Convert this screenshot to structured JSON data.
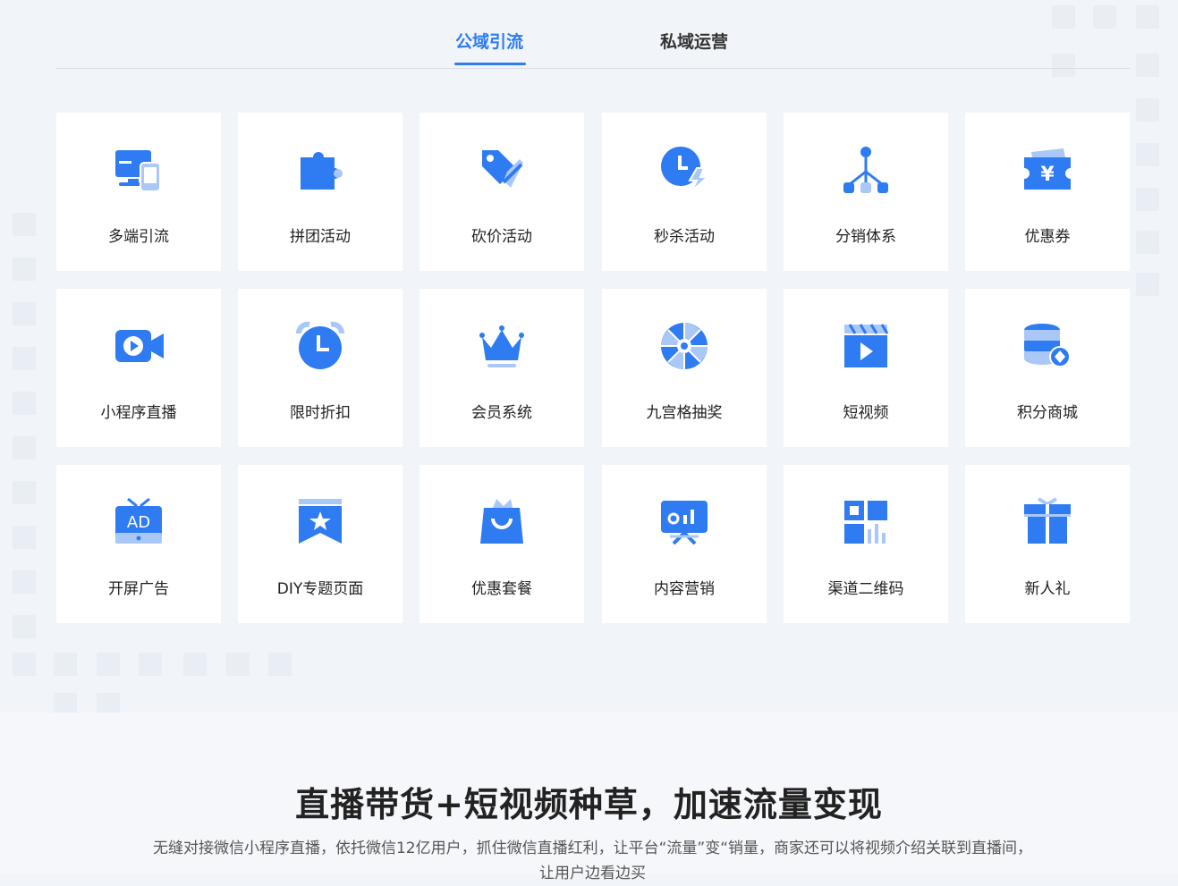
{
  "tabs": [
    {
      "label": "公域引流",
      "active": true
    },
    {
      "label": "私域运营",
      "active": false
    }
  ],
  "features": [
    {
      "label": "多端引流",
      "icon": "multi-device-icon"
    },
    {
      "label": "拼团活动",
      "icon": "puzzle-icon"
    },
    {
      "label": "砍价活动",
      "icon": "price-tag-icon"
    },
    {
      "label": "秒杀活动",
      "icon": "flash-clock-icon"
    },
    {
      "label": "分销体系",
      "icon": "hierarchy-icon"
    },
    {
      "label": "优惠券",
      "icon": "yen-ticket-icon"
    },
    {
      "label": "小程序直播",
      "icon": "video-camera-icon"
    },
    {
      "label": "限时折扣",
      "icon": "alarm-clock-icon"
    },
    {
      "label": "会员系统",
      "icon": "crown-icon"
    },
    {
      "label": "九宫格抽奖",
      "icon": "prize-wheel-icon"
    },
    {
      "label": "短视频",
      "icon": "clapperboard-icon"
    },
    {
      "label": "积分商城",
      "icon": "coin-stack-icon"
    },
    {
      "label": "开屏广告",
      "icon": "ad-tv-icon"
    },
    {
      "label": "DIY专题页面",
      "icon": "star-bookmark-icon"
    },
    {
      "label": "优惠套餐",
      "icon": "shopping-bag-icon"
    },
    {
      "label": "内容营销",
      "icon": "presentation-board-icon"
    },
    {
      "label": "渠道二维码",
      "icon": "qr-code-icon"
    },
    {
      "label": "新人礼",
      "icon": "gift-icon"
    }
  ],
  "section": {
    "title": "直播带货+短视频种草，加速流量变现",
    "description": "无缝对接微信小程序直播，依托微信12亿用户，抓住微信直播红利，让平台“流量”变“销量，商家还可以将视频介绍关联到直播间，让用户边看边买"
  },
  "colors": {
    "accent": "#2e7bf2",
    "accent_light": "#a9c8f8"
  }
}
